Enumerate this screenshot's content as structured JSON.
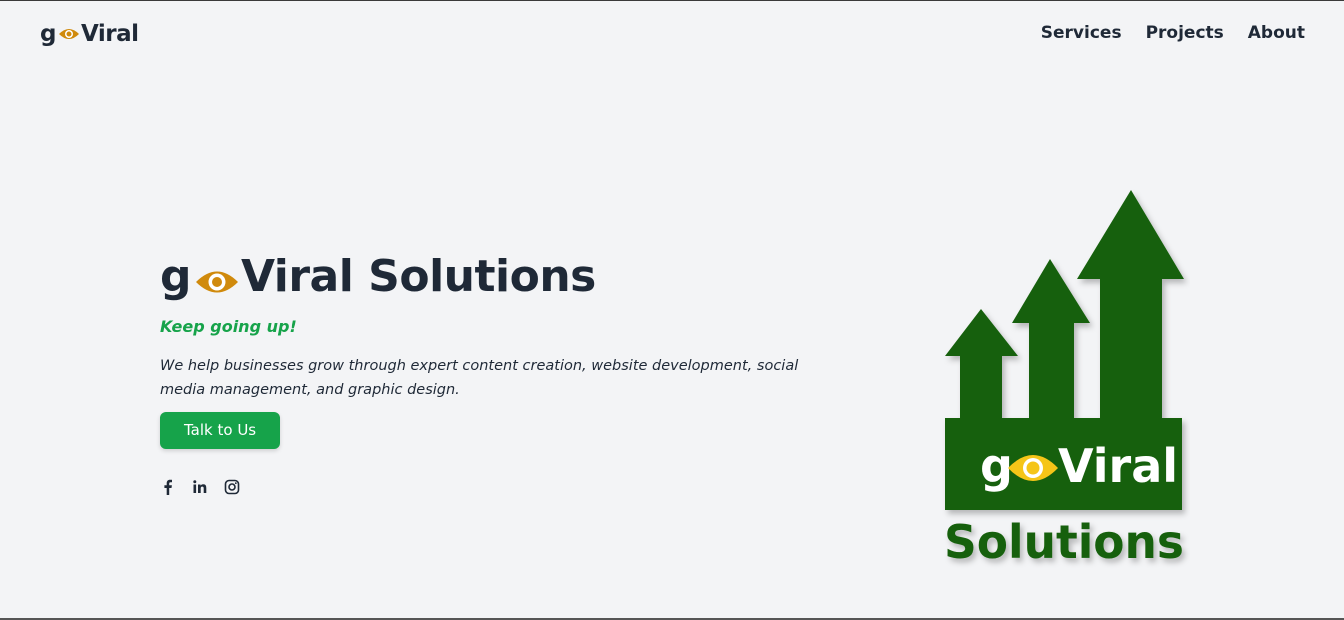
{
  "header": {
    "brand_prefix": "g",
    "brand_suffix": "Viral",
    "nav": [
      {
        "label": "Services"
      },
      {
        "label": "Projects"
      },
      {
        "label": "About"
      }
    ]
  },
  "hero": {
    "title_prefix": "g",
    "title_suffix": "Viral Solutions",
    "tagline": "Keep going up!",
    "description": "We help businesses grow through expert content creation, website development, social media management, and graphic design.",
    "cta_label": "Talk to Us",
    "socials": [
      "facebook-icon",
      "linkedin-icon",
      "instagram-icon"
    ]
  },
  "logo": {
    "line1_prefix": "g",
    "line1_suffix": "Viral",
    "line2": "Solutions"
  },
  "colors": {
    "background": "#f3f4f6",
    "text_dark": "#1f2937",
    "accent_green": "#16a34a",
    "logo_green": "#16600a",
    "eye_orange": "#d08a0c",
    "eye_yellow": "#f5c518"
  }
}
